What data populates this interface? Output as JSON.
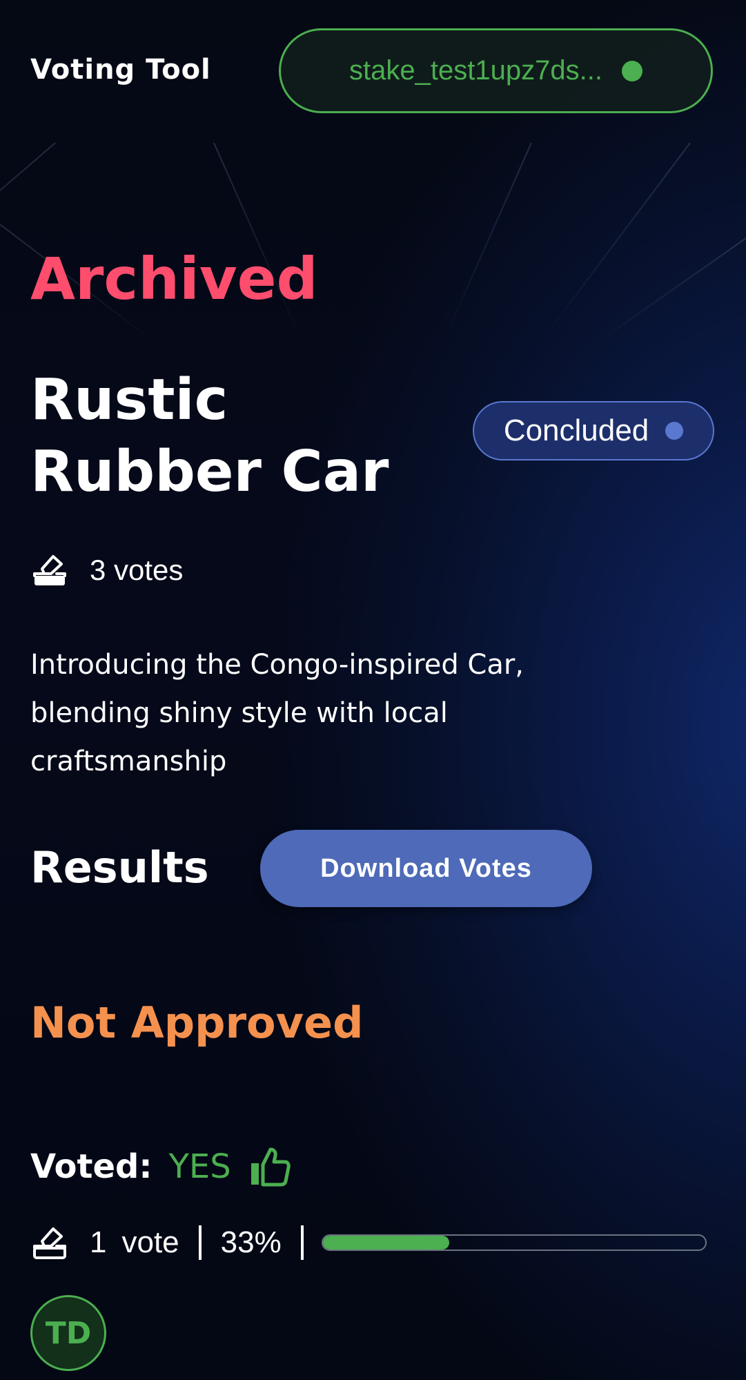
{
  "header": {
    "app_title": "Voting Tool",
    "wallet_address": "stake_test1upz7ds...",
    "wallet_status_color": "#4caf50"
  },
  "proposal": {
    "status_heading": "Archived",
    "title": "Rustic Rubber Car",
    "state_badge": "Concluded",
    "vote_count": "3 votes",
    "description": "Introducing the Congo-inspired Car, blending shiny style with local craftsmanship"
  },
  "results": {
    "heading": "Results",
    "download_button": "Download Votes",
    "outcome": "Not Approved",
    "option": {
      "voted_label": "Voted:",
      "choice": "YES",
      "count": "1",
      "unit": "vote",
      "percent": "33%",
      "fraction": 0.33,
      "voter_initials": "TD"
    }
  },
  "icons": {
    "ballot": "ballot-box-icon",
    "thumb": "thumbs-up-icon"
  },
  "colors": {
    "archived": "#ff4d6d",
    "not_approved": "#f5914e",
    "yes": "#4caf50",
    "button": "#4e6ab8",
    "badge_bg": "#1d2f6b",
    "badge_dot": "#5a78d0"
  }
}
